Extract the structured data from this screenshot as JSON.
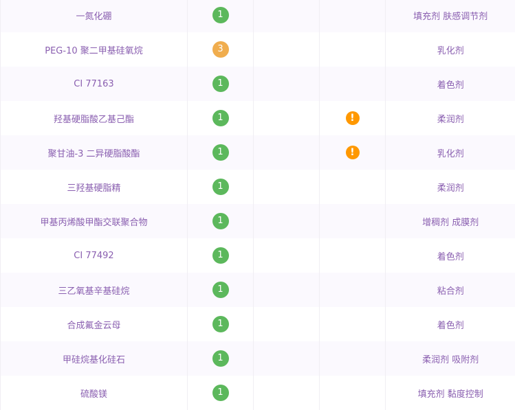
{
  "colors": {
    "safe": "#5cb85c",
    "moderate": "#f0ad4e",
    "warning": "#ff9800",
    "text": "#8a5fb0"
  },
  "rows": [
    {
      "name": "一氮化硼",
      "score": "1",
      "level": "safe",
      "warning": false,
      "purpose": "填充剂 肤感调节剂"
    },
    {
      "name": "PEG-10 聚二甲基硅氧烷",
      "score": "3",
      "level": "moderate",
      "warning": false,
      "purpose": "乳化剂"
    },
    {
      "name": "CI 77163",
      "score": "1",
      "level": "safe",
      "warning": false,
      "purpose": "着色剂"
    },
    {
      "name": "羟基硬脂酸乙基己酯",
      "score": "1",
      "level": "safe",
      "warning": true,
      "purpose": "柔润剂"
    },
    {
      "name": "聚甘油-3 二异硬脂酸酯",
      "score": "1",
      "level": "safe",
      "warning": true,
      "purpose": "乳化剂"
    },
    {
      "name": "三羟基硬脂精",
      "score": "1",
      "level": "safe",
      "warning": false,
      "purpose": "柔润剂"
    },
    {
      "name": "甲基丙烯酸甲酯交联聚合物",
      "score": "1",
      "level": "safe",
      "warning": false,
      "purpose": "增稠剂 成膜剂"
    },
    {
      "name": "CI 77492",
      "score": "1",
      "level": "safe",
      "warning": false,
      "purpose": "着色剂"
    },
    {
      "name": "三乙氧基辛基硅烷",
      "score": "1",
      "level": "safe",
      "warning": false,
      "purpose": "粘合剂"
    },
    {
      "name": "合成氟金云母",
      "score": "1",
      "level": "safe",
      "warning": false,
      "purpose": "着色剂"
    },
    {
      "name": "甲硅烷基化硅石",
      "score": "1",
      "level": "safe",
      "warning": false,
      "purpose": "柔润剂 吸附剂"
    },
    {
      "name": "硫酸镁",
      "score": "1",
      "level": "safe",
      "warning": false,
      "purpose": "填充剂 黏度控制"
    }
  ],
  "warning_icon": "!"
}
